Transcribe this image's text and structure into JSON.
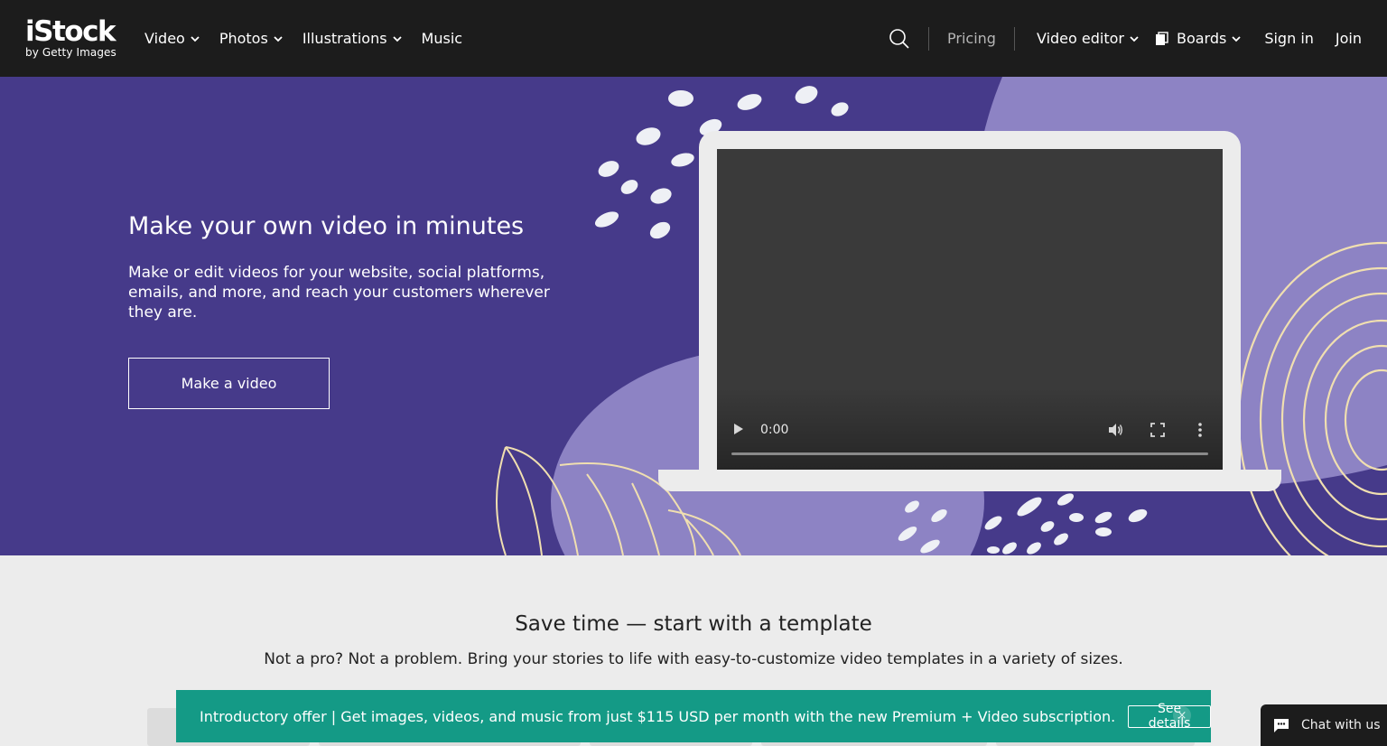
{
  "header": {
    "logo_word": "iStock",
    "logo_sub": "by Getty Images",
    "nav": [
      {
        "label": "Video",
        "dropdown": true
      },
      {
        "label": "Photos",
        "dropdown": true
      },
      {
        "label": "Illustrations",
        "dropdown": true
      },
      {
        "label": "Music",
        "dropdown": false
      }
    ],
    "pricing": "Pricing",
    "video_editor": "Video editor",
    "boards": "Boards",
    "sign_in": "Sign in",
    "join": "Join"
  },
  "hero": {
    "title": "Make your own video in minutes",
    "description": "Make or edit videos for your website, social platforms, emails, and more, and reach your customers wherever they are.",
    "cta": "Make a video",
    "video": {
      "time": "0:00",
      "progress": 0
    }
  },
  "templates": {
    "title": "Save time — start with a template",
    "subtitle": "Not a pro? Not a problem. Bring your stories to life with easy-to-customize video templates in a variety of sizes."
  },
  "promo": {
    "text": "Introductory offer | Get images, videos, and music from just $115 USD per month with the new Premium + Video subscription.",
    "button": "See details",
    "close": "×"
  },
  "chat": {
    "label": "Chat with us"
  },
  "colors": {
    "header_bg": "#1c1c1c",
    "hero_bg": "#463a8a",
    "hero_accent": "#8d83c4",
    "promo_bg": "#149a86",
    "page_bg": "#ececec"
  }
}
